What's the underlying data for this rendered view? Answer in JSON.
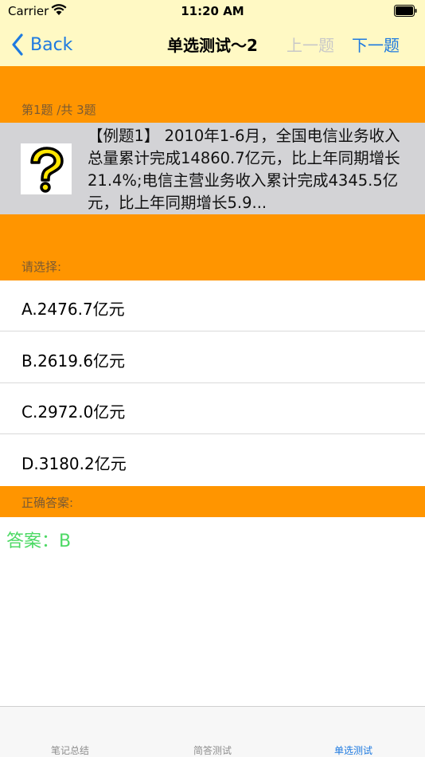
{
  "status": {
    "carrier": "Carrier",
    "time": "11:20 AM"
  },
  "nav": {
    "back_label": "Back",
    "title": "单选测试～2",
    "prev_label": "上一题",
    "next_label": "下一题"
  },
  "question": {
    "counter": "第1题 /共 3题",
    "text": "【例题1】 2010年1-6月，全国电信业务收入总量累计完成14860.7亿元，比上年同期增长21.4%;电信主营业务收入累计完成4345.5亿元，比上年同期增长5.9..."
  },
  "choose_label": "请选择:",
  "options": [
    {
      "label": "A.2476.7亿元"
    },
    {
      "label": "B.2619.6亿元"
    },
    {
      "label": "C.2972.0亿元"
    },
    {
      "label": "D.3180.2亿元"
    }
  ],
  "answer": {
    "section_label": "正确答案:",
    "text": "答案：B"
  },
  "tabs": [
    {
      "label": "笔记总结",
      "active": false
    },
    {
      "label": "简答测试",
      "active": false
    },
    {
      "label": "单选测试",
      "active": true
    }
  ],
  "colors": {
    "accent": "#1e7ae0",
    "orange": "#ff9500",
    "answer_green": "#4cd964",
    "bar_yellow": "#fff9c4"
  }
}
